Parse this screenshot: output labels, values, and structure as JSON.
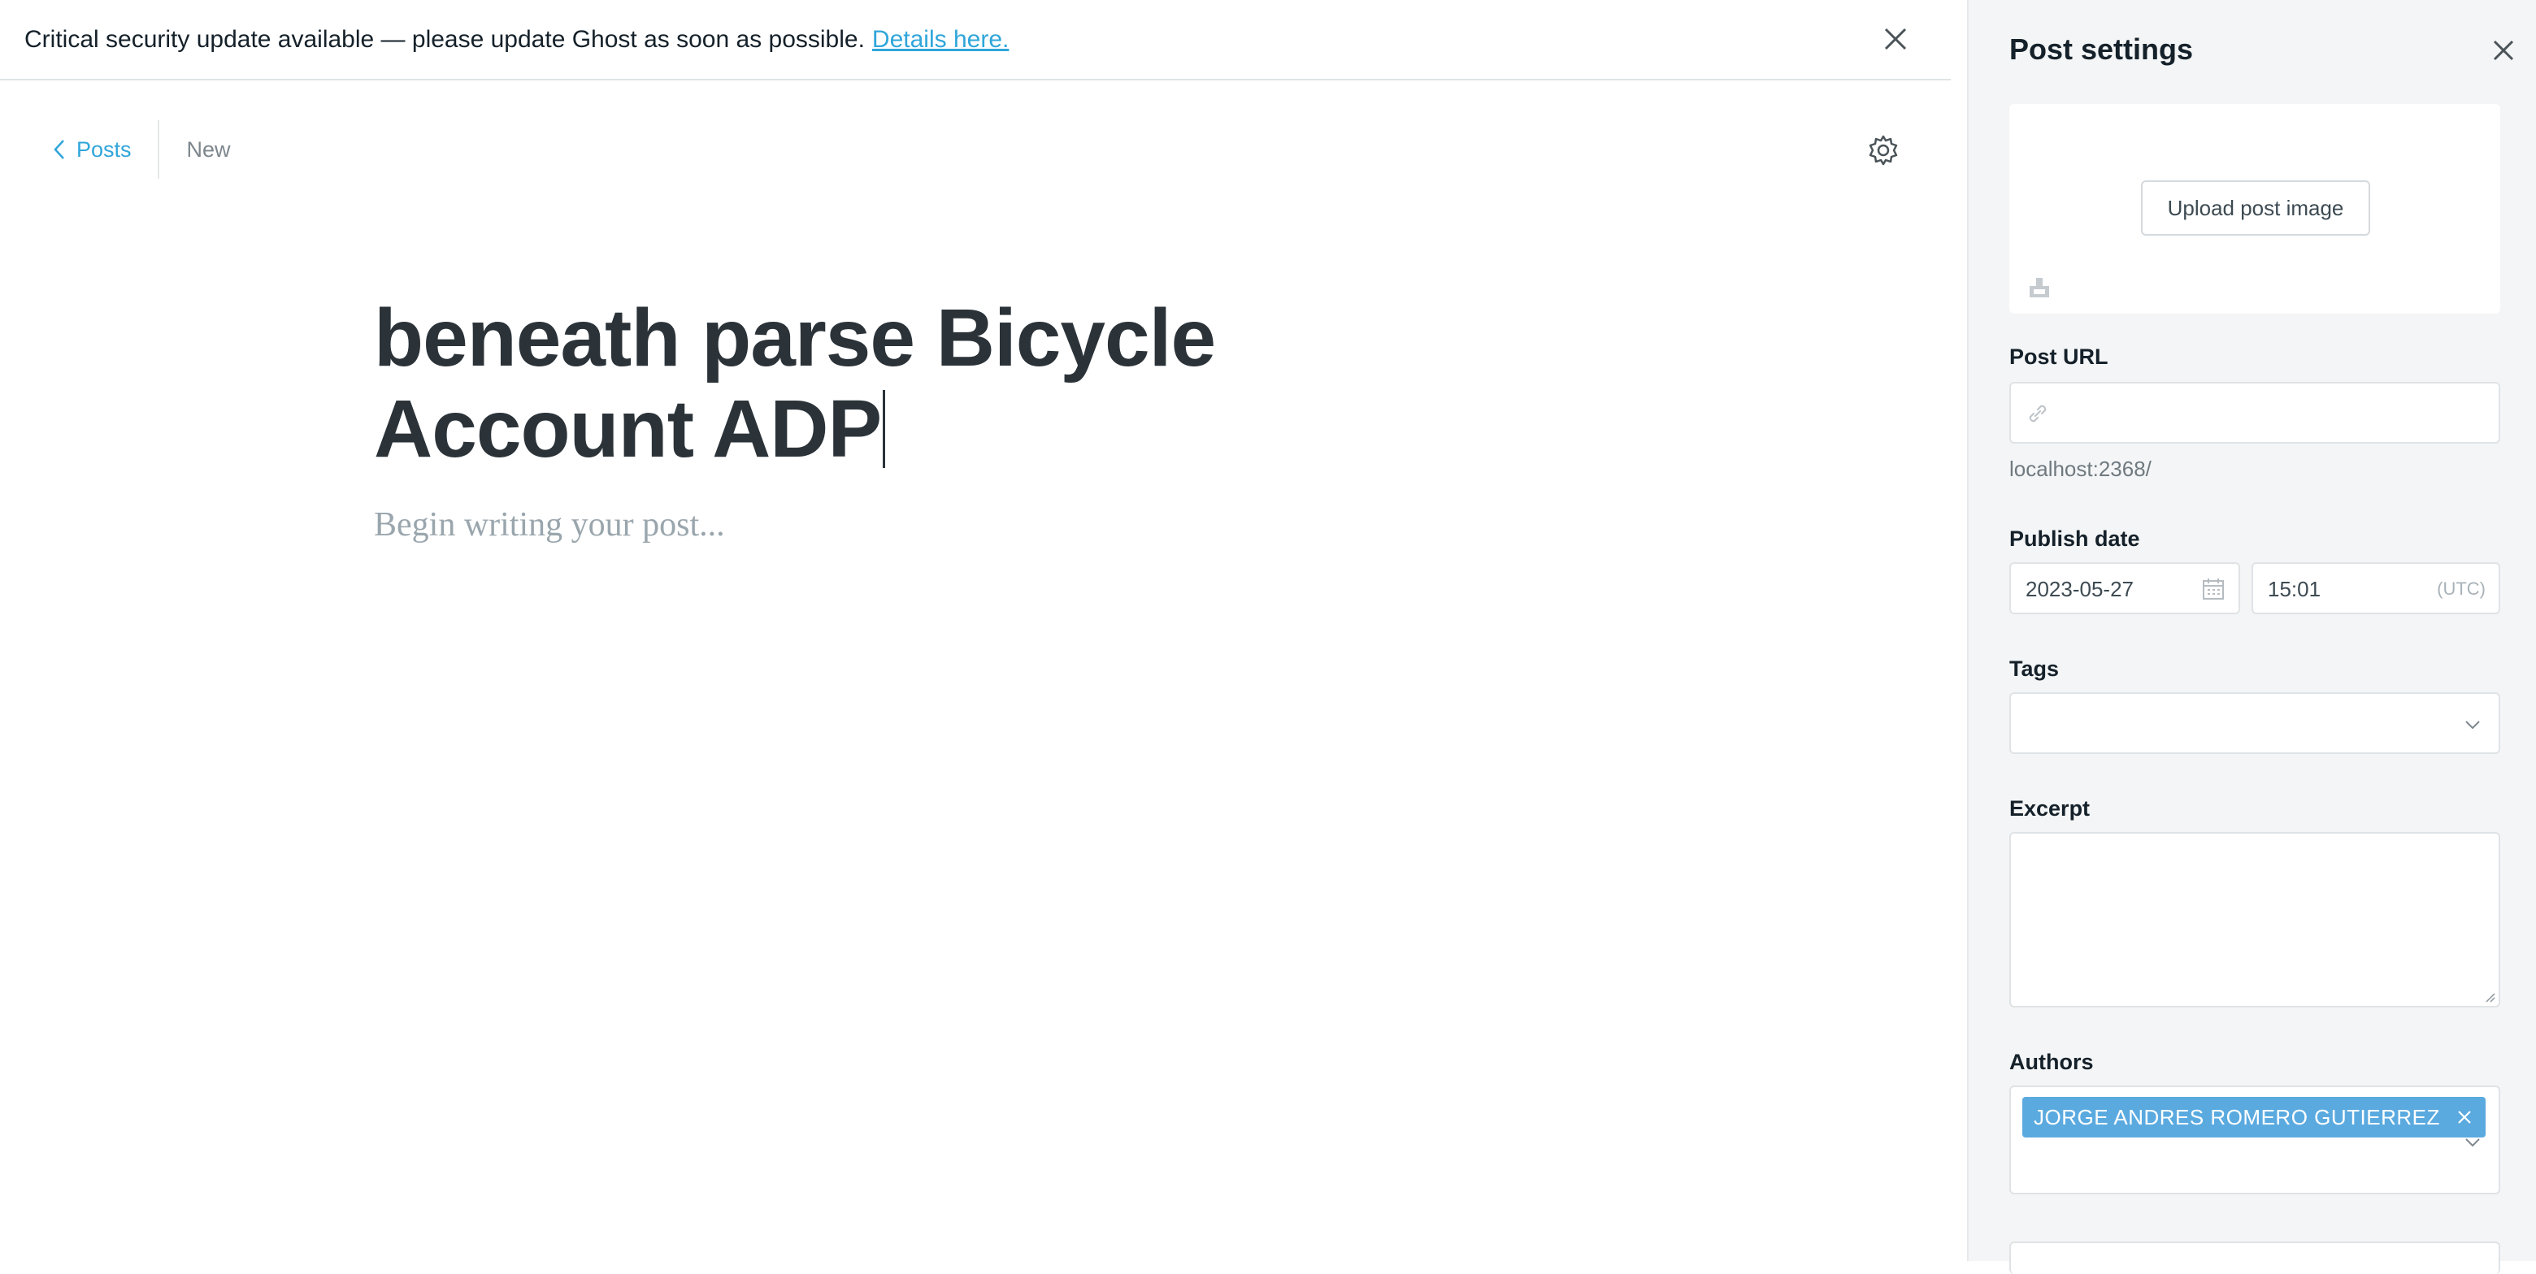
{
  "banner": {
    "message": "Critical security update available — please update Ghost as soon as possible.",
    "link_label": "Details here."
  },
  "nav": {
    "back_label": "Posts",
    "status": "New"
  },
  "editor": {
    "title": "beneath parse Bicycle Account ADP",
    "body_placeholder": "Begin writing your post..."
  },
  "settings": {
    "title": "Post settings",
    "upload_label": "Upload post image",
    "url_label": "Post URL",
    "url_value": "",
    "url_hint": "localhost:2368/",
    "publish_label": "Publish date",
    "date": "2023-05-27",
    "time": "15:01",
    "timezone": "(UTC)",
    "tags_label": "Tags",
    "excerpt_label": "Excerpt",
    "excerpt_value": "",
    "authors_label": "Authors",
    "authors": [
      "JORGE ANDRES ROMERO GUTIERREZ"
    ]
  },
  "colors": {
    "accent": "#30a6da",
    "chip": "#5aaae0",
    "panel": "#f4f5f6"
  },
  "icons": [
    "close-icon",
    "chevron-left-icon",
    "gear-icon",
    "image-icon",
    "link-icon",
    "calendar-icon",
    "chevron-down-icon"
  ]
}
